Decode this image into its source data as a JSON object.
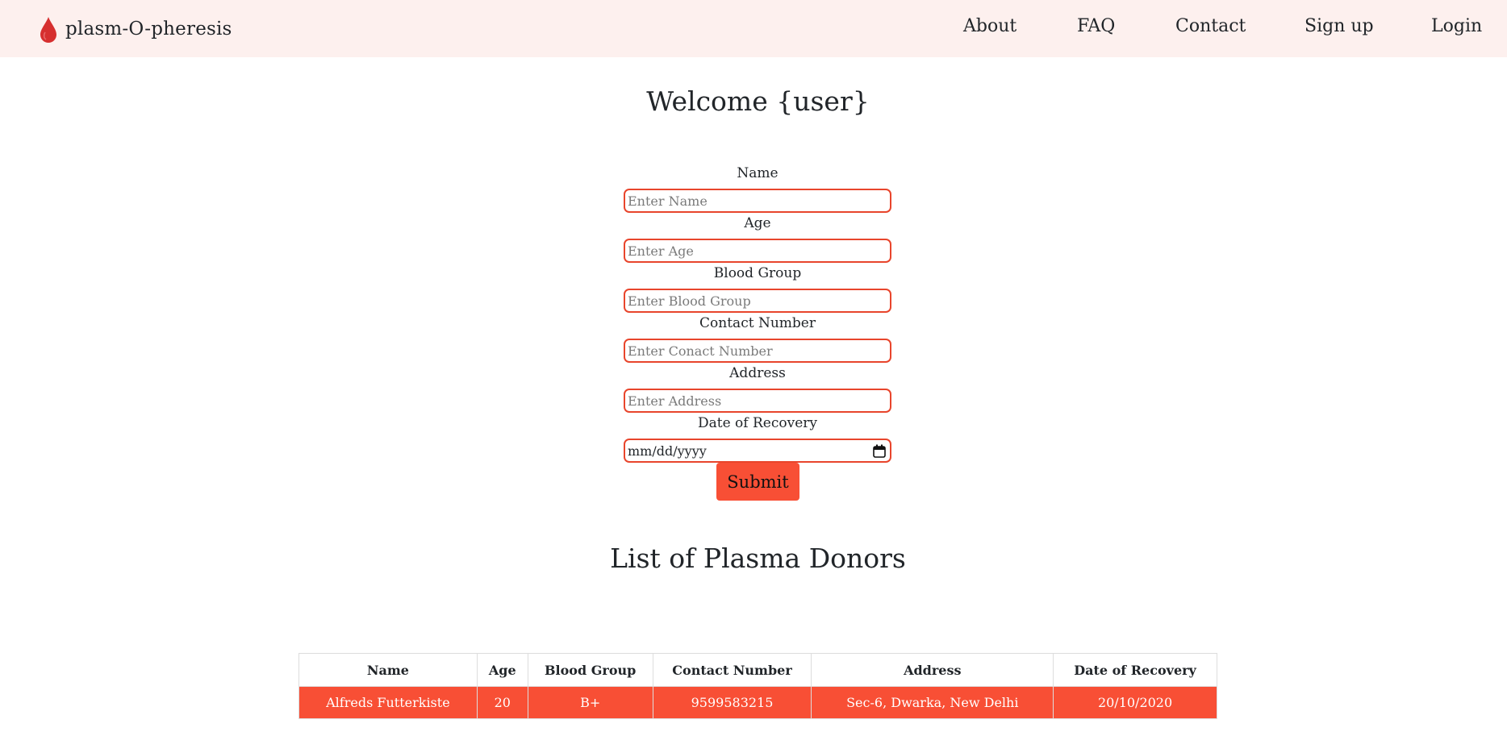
{
  "brand": {
    "name": "plasm-O-pheresis",
    "icon": "blood-drop-icon",
    "icon_color": "#d62f2f"
  },
  "nav": {
    "about": "About",
    "faq": "FAQ",
    "contact": "Contact",
    "signup": "Sign up",
    "login": "Login"
  },
  "welcome": "Welcome {user}",
  "form": {
    "name_label": "Name",
    "name_placeholder": "Enter Name",
    "age_label": "Age",
    "age_placeholder": "Enter Age",
    "blood_group_label": "Blood Group",
    "blood_group_placeholder": "Enter Blood Group",
    "contact_label": "Contact Number",
    "contact_placeholder": "Enter Conact Number",
    "address_label": "Address",
    "address_placeholder": "Enter Address",
    "recovery_label": "Date of Recovery",
    "recovery_value": "mm/dd/yyyy",
    "submit_label": "Submit"
  },
  "list_title": "List of Plasma Donors",
  "table": {
    "headers": [
      "Name",
      "Age",
      "Blood Group",
      "Contact Number",
      "Address",
      "Date of Recovery"
    ],
    "rows": [
      [
        "Alfreds Futterkiste",
        "20",
        "B+",
        "9599583215",
        "Sec-6, Dwarka, New Delhi",
        "20/10/2020"
      ]
    ]
  },
  "colors": {
    "navbar_bg": "#fdf0ee",
    "accent": "#f84f35",
    "input_border": "#e8452c"
  }
}
